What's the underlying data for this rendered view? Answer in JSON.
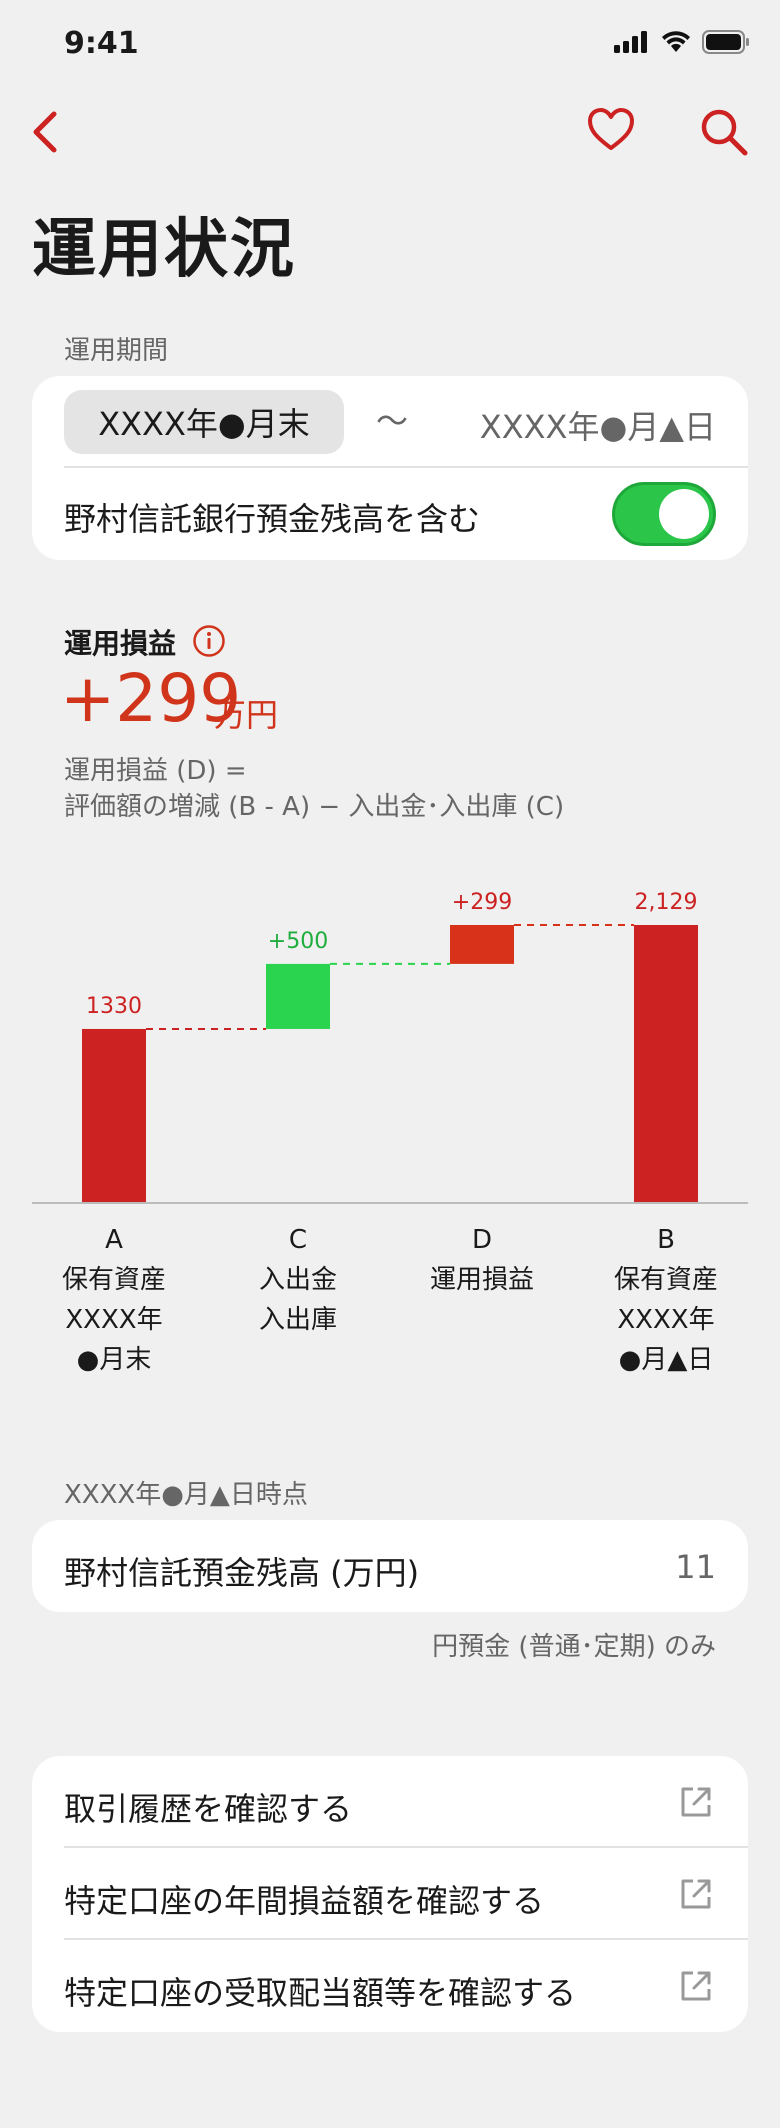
{
  "status": {
    "time": "9:41"
  },
  "header": {
    "title": "運用状況"
  },
  "period": {
    "section_label": "運用期間",
    "start": "XXXX年●月末",
    "separator": "〜",
    "end": "XXXX年●月▲日",
    "toggle_label": "野村信託銀行預金残高を含む",
    "toggle_on": true
  },
  "profit": {
    "label": "運用損益",
    "value": "+299",
    "unit": "万円",
    "formula_line1": "運用損益 (D)  =",
    "formula_line2": "評価額の増減 (B - A)  −  入出金･入出庫 (C)"
  },
  "chart_data": {
    "type": "bar",
    "subtype": "waterfall",
    "categories": [
      {
        "code": "A",
        "lines": [
          "保有資産",
          "XXXX年",
          "●月末"
        ]
      },
      {
        "code": "C",
        "lines": [
          "入出金",
          "入出庫"
        ]
      },
      {
        "code": "D",
        "lines": [
          "運用損益"
        ]
      },
      {
        "code": "B",
        "lines": [
          "保有資産",
          "XXXX年",
          "●月▲日"
        ]
      }
    ],
    "values": [
      1330,
      500,
      299,
      2129
    ],
    "value_labels": [
      "1330",
      "+500",
      "+299",
      "2,129"
    ],
    "colors": [
      "#cc2222",
      "#2bd44e",
      "#d8331a",
      "#cc2222"
    ],
    "connector_colors": [
      "#cc2222",
      "#2bd44e",
      "#d8331a"
    ],
    "ylim": [
      0,
      2129
    ]
  },
  "balance": {
    "section_label": "XXXX年●月▲日時点",
    "label": "野村信託預金残高 (万円)",
    "value": "11",
    "note": "円預金 (普通･定期) のみ"
  },
  "links": [
    {
      "label": "取引履歴を確認する",
      "icon": "external-link-icon"
    },
    {
      "label": "特定口座の年間損益額を確認する",
      "icon": "external-link-icon"
    },
    {
      "label": "特定口座の受取配当額等を確認する",
      "icon": "external-link-icon"
    }
  ],
  "colors": {
    "accent": "#cc2222",
    "profit": "#d0351c",
    "toggle": "#2bc54a"
  }
}
